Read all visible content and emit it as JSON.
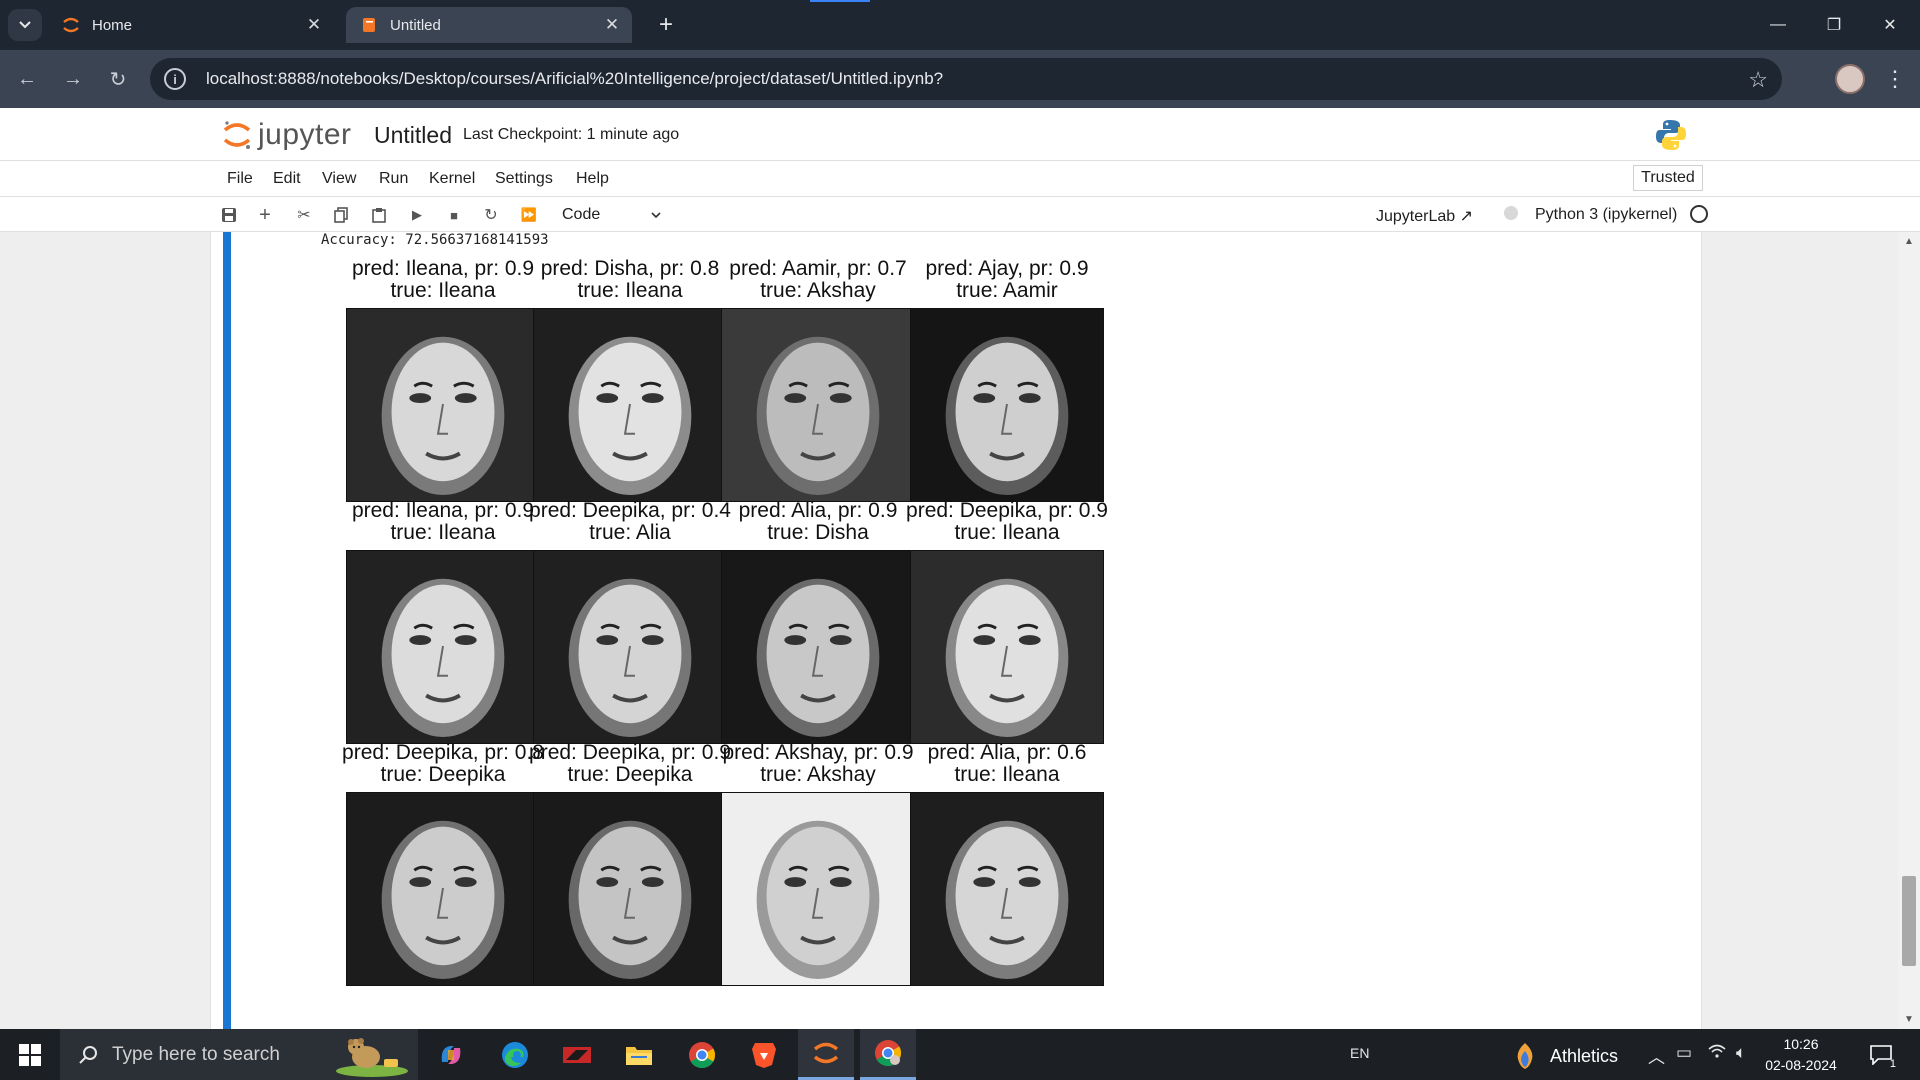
{
  "browser": {
    "tabs": [
      {
        "title": "Home",
        "active": false
      },
      {
        "title": "Untitled",
        "active": true
      }
    ],
    "url": "localhost:8888/notebooks/Desktop/courses/Arificial%20Intelligence/project/dataset/Untitled.ipynb?"
  },
  "jupyter": {
    "logo_text": "jupyter",
    "notebook_title": "Untitled",
    "checkpoint": "Last Checkpoint: 1 minute ago",
    "menu": [
      "File",
      "Edit",
      "View",
      "Run",
      "Kernel",
      "Settings",
      "Help"
    ],
    "trusted": "Trusted",
    "cell_type": "Code",
    "jupyterlab_link": "JupyterLab",
    "kernel": "Python 3 (ipykernel)"
  },
  "output": {
    "accuracy_text": "Accuracy: 72.56637168141593",
    "predictions": [
      {
        "pred": "pred: Ileana, pr: 0.9",
        "true": "true: Ileana"
      },
      {
        "pred": "pred: Disha, pr: 0.8",
        "true": "true: Ileana"
      },
      {
        "pred": "pred: Aamir, pr: 0.7",
        "true": "true: Akshay"
      },
      {
        "pred": "pred: Ajay, pr: 0.9",
        "true": "true: Aamir"
      },
      {
        "pred": "pred: Ileana, pr: 0.9",
        "true": "true: Ileana"
      },
      {
        "pred": "pred: Deepika, pr: 0.4",
        "true": "true: Alia"
      },
      {
        "pred": "pred: Alia, pr: 0.9",
        "true": "true: Disha"
      },
      {
        "pred": "pred: Deepika, pr: 0.9",
        "true": "true: Ileana"
      },
      {
        "pred": "pred: Deepika, pr: 0.8",
        "true": "true: Deepika"
      },
      {
        "pred": "pred: Deepika, pr: 0.9",
        "true": "true: Deepika"
      },
      {
        "pred": "pred: Akshay, pr: 0.9",
        "true": "true: Akshay"
      },
      {
        "pred": "pred: Alia, pr: 0.6",
        "true": "true: Ileana"
      }
    ]
  },
  "taskbar": {
    "search_placeholder": "Type here to search",
    "language": "EN",
    "weather": "Athletics",
    "time": "10:26",
    "date": "02-08-2024",
    "notification_count": "1"
  }
}
